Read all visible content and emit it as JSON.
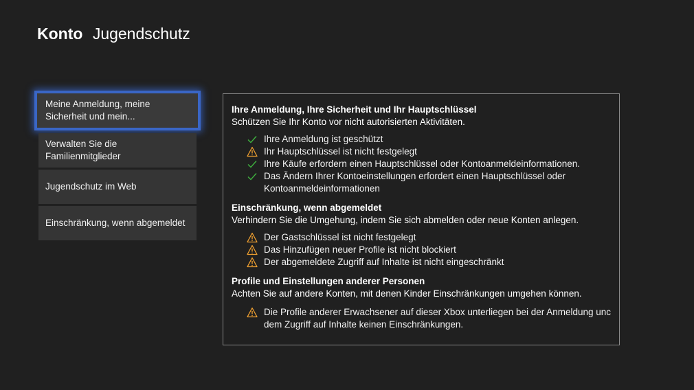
{
  "header": {
    "section": "Konto",
    "page": "Jugendschutz"
  },
  "menu": {
    "items": [
      {
        "line1": "Meine Anmeldung, meine",
        "line2": "Sicherheit und mein...",
        "selected": true
      },
      {
        "line1": "Verwalten Sie die",
        "line2": "Familienmitglieder",
        "selected": false
      },
      {
        "line1": "Jugendschutz im Web",
        "line2": "",
        "selected": false
      },
      {
        "line1": "Einschränkung, wenn abgemeldet",
        "line2": "",
        "selected": false
      }
    ]
  },
  "panel": {
    "sections": [
      {
        "title": "Ihre Anmeldung, Ihre Sicherheit und Ihr Hauptschlüssel",
        "description": "Schützen Sie Ihr Konto vor nicht autorisierten Aktivitäten.",
        "items": [
          {
            "status": "check-icon",
            "line1": "Ihre Anmeldung ist geschützt",
            "line2": ""
          },
          {
            "status": "warning-icon",
            "line1": "Ihr Hauptschlüssel ist nicht festgelegt",
            "line2": ""
          },
          {
            "status": "check-icon",
            "line1": "Ihre Käufe erfordern einen Hauptschlüssel oder Kontoanmeldeinformationen.",
            "line2": ""
          },
          {
            "status": "check-icon",
            "line1": "Das Ändern Ihrer Kontoeinstellungen erfordert einen Hauptschlüssel oder",
            "line2": "Kontoanmeldeinformationen"
          }
        ]
      },
      {
        "title": "Einschränkung, wenn abgemeldet",
        "description": "Verhindern Sie die Umgehung, indem Sie sich abmelden oder neue Konten anlegen.",
        "items": [
          {
            "status": "warning-icon",
            "line1": "Der Gastschlüssel ist nicht festgelegt",
            "line2": ""
          },
          {
            "status": "warning-icon",
            "line1": "Das Hinzufügen neuer Profile ist nicht blockiert",
            "line2": ""
          },
          {
            "status": "warning-icon",
            "line1": "Der abgemeldete Zugriff auf Inhalte ist nicht eingeschränkt",
            "line2": ""
          }
        ]
      },
      {
        "title": "Profile und Einstellungen anderer Personen",
        "description": "Achten Sie auf andere Konten, mit denen Kinder Einschränkungen umgehen können.",
        "items": [
          {
            "status": "warning-icon",
            "line1": "Die Profile anderer Erwachsener auf dieser Xbox unterliegen bei der Anmeldung unc",
            "line2": "dem Zugriff auf Inhalte keinen Einschränkungen."
          }
        ]
      }
    ]
  },
  "colors": {
    "background": "#202020",
    "menu_item": "#353535",
    "focus_border": "#3a66c6",
    "check": "#3fb23f",
    "warning": "#f0a030",
    "panel_border": "#8a8a8a"
  }
}
